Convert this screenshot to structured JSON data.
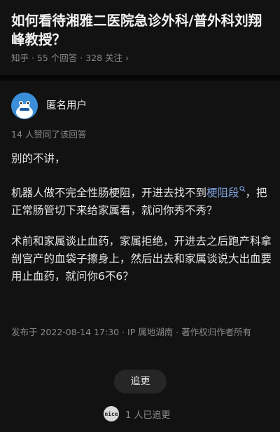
{
  "question": {
    "title": "如何看待湘雅二医院急诊外科/普外科刘翔峰教授？",
    "meta": "知乎 · 55 个回答 · 328 关注 ›"
  },
  "answer": {
    "author": "匿名用户",
    "upvotes": "14 人赞同了该回答",
    "p1": "别的不讲，",
    "p2_before": "机器人做不完全性肠梗阻，开进去找不到",
    "p2_link": "梗阻段",
    "p2_after": "，把正常肠管切下来给家属看，就问你秀不秀？",
    "p3": "术前和家属谈止血药，家属拒绝，开进去之后跑产科拿剖宫产的血袋子擦身上，然后出去和家属谈说大出血要用止血药，就问你6不6？",
    "footer": "发布于 2022-08-14 17:30 · IP 属地湖南 · 著作权归作者所有"
  },
  "follow": {
    "button_label": "追更",
    "follower_avatar_text": "nice",
    "count_text": "1 人已追更"
  },
  "colors": {
    "background": "#121212",
    "link": "#7fa2dd",
    "meta_text": "#8a8a8a"
  },
  "icons": {
    "search": "magnifier-icon",
    "avatar": "anonymous-mascot-avatar"
  }
}
